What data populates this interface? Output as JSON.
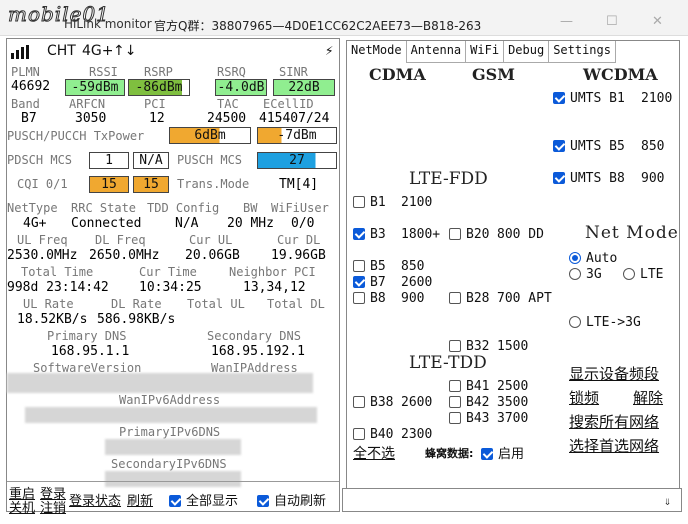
{
  "window": {
    "watermark": "mobile01",
    "title": "HiLink monitor",
    "qq_group": "官方Q群：38807965—4D0E1CC62C2AEE73—B818-263"
  },
  "status": {
    "operator": "CHT",
    "network": "4G+",
    "updown": "↑↓"
  },
  "signal": {
    "labels": {
      "plmn": "PLMN",
      "rssi": "RSSI",
      "rsrp": "RSRP",
      "rsrq": "RSRQ",
      "sinr": "SINR"
    },
    "plmn": "46692",
    "rssi": "-59dBm",
    "rsrp": "-86dBm",
    "rsrq": "-4.0dB",
    "sinr": "22dB",
    "band_labels": {
      "band": "Band",
      "arfcn": "ARFCN",
      "pci": "PCI",
      "tac": "TAC",
      "ecell": "ECellID"
    },
    "band": "B7",
    "arfcn": "3050",
    "pci": "12",
    "tac": "24500",
    "ecell": "415407/24",
    "txpower_label": "PUSCH/PUCCH TxPower",
    "tx_pusch": "6dBm",
    "tx_pucch": "-7dBm",
    "pdsch_label": "PDSCH MCS",
    "pdsch_1": "1",
    "pdsch_2": "N/A",
    "pusch_label": "PUSCH MCS",
    "pusch": "27",
    "cqi_label": "CQI 0/1",
    "cqi_0": "15",
    "cqi_1": "15",
    "trans_label": "Trans.Mode",
    "trans": "TM[4]"
  },
  "colors": {
    "rssi_fill": "#90ee90",
    "rsrp_fill": "#7fbf3f",
    "rsrq_fill": "#90ee90",
    "sinr_fill": "#90ee90",
    "tx_fill": "#f0a830",
    "pusch_fill": "#1ea0e0",
    "cqi_fill": "#f0a830",
    "accent": "#0b5ad9"
  },
  "levels": {
    "rsrp_fill_fraction": 0.88,
    "tx_pusch_fill_fraction": 0.62,
    "tx_pucch_fill_fraction": 0.3,
    "pusch_fill_fraction": 0.74
  },
  "net": {
    "h_nettype": "NetType",
    "h_rrc": "RRC State",
    "h_tdd": "TDD Config",
    "h_bw": "BW",
    "h_wifi": "WiFiUser",
    "nettype": "4G+",
    "rrc": "Connected",
    "tdd": "N/A",
    "bw": "20 MHz",
    "wifi": "0/0",
    "h_ulfreq": "UL Freq",
    "h_dlfreq": "DL Freq",
    "h_curul": "Cur UL",
    "h_curdl": "Cur DL",
    "ulfreq": "2530.0MHz",
    "dlfreq": "2650.0MHz",
    "curul": "20.06GB",
    "curdl": "19.96GB",
    "h_total": "Total Time",
    "h_cur": "Cur Time",
    "h_neighbor": "Neighbor PCI",
    "total": "998d 23:14:42",
    "cur": "10:34:25",
    "neighbor": "13,34,12",
    "h_ulrate": "UL Rate",
    "h_dlrate": "DL Rate",
    "h_totalul": "Total UL",
    "h_totaldl": "Total DL",
    "ulrate": "18.52KB/s",
    "dlrate": "586.98KB/s",
    "h_pdns": "Primary DNS",
    "h_sdns": "Secondary DNS",
    "pdns": "168.95.1.1",
    "sdns": "168.95.192.1",
    "h_sw": "SoftwareVersion",
    "h_wanip": "WanIPAddress",
    "h_wanipv6": "WanIPv6Address",
    "h_pipv6dns": "PrimaryIPv6DNS",
    "h_sipv6dns": "SecondaryIPv6DNS"
  },
  "bottom": {
    "reboot": "重启",
    "shutdown": "关机",
    "login": "登录",
    "logout": "注销",
    "login_status": "登录状态",
    "refresh": "刷新",
    "show_all": "全部显示",
    "auto_refresh": "自动刷新"
  },
  "tabs": [
    "NetMode",
    "Antenna",
    "WiFi",
    "Debug",
    "Settings"
  ],
  "netmode": {
    "cdma": "CDMA",
    "gsm": "GSM",
    "wcdma": "WCDMA",
    "umts_b1": "UMTS B1",
    "umts_b1_f": "2100",
    "umts_b5": "UMTS B5",
    "umts_b5_f": "850",
    "umts_b8": "UMTS B8",
    "umts_b8_f": "900",
    "lte_fdd": "LTE-FDD",
    "lte_tdd": "LTE-TDD",
    "b1": "B1",
    "b1_f": "2100",
    "b3": "B3",
    "b3_f": "1800+",
    "b20": "B20",
    "b20_f": "800 DD",
    "b5": "B5",
    "b5_f": "850",
    "b7": "B7",
    "b7_f": "2600",
    "b8": "B8",
    "b8_f": "900",
    "b28": "B28",
    "b28_f": "700 APT",
    "b32": "B32",
    "b32_f": "1500",
    "b41": "B41",
    "b41_f": "2500",
    "b42": "B42",
    "b42_f": "3500",
    "b43": "B43",
    "b43_f": "3700",
    "b38": "B38",
    "b38_f": "2600",
    "b40": "B40",
    "b40_f": "2300",
    "net_mode": "Net Mode",
    "auto": "Auto",
    "r3g": "3G",
    "lte": "LTE",
    "lte3g": "LTE->3G",
    "show_bands": "显示设备频段",
    "lock": "锁频",
    "unlock": "解除",
    "search_all": "搜索所有网络",
    "select_pref": "选择首选网络",
    "uncheck_all": "全不选",
    "cell_data": "蜂窝数据:",
    "enable": "启用"
  }
}
